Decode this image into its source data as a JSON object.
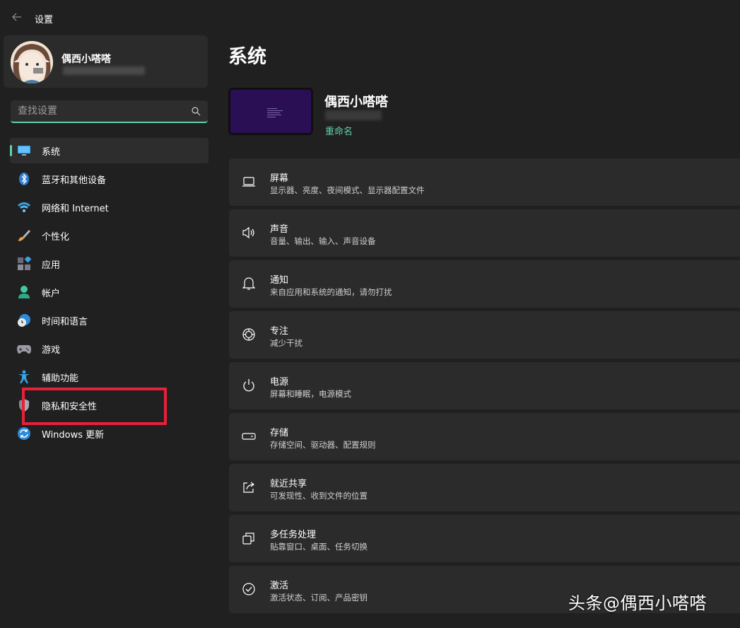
{
  "window": {
    "title": "设置"
  },
  "profile": {
    "name": "偶西小嗒嗒"
  },
  "search": {
    "placeholder": "查找设置"
  },
  "sidebar": {
    "items": [
      {
        "label": "系统",
        "icon": "monitor-icon",
        "active": true
      },
      {
        "label": "蓝牙和其他设备",
        "icon": "bluetooth-icon"
      },
      {
        "label": "网络和 Internet",
        "icon": "wifi-icon"
      },
      {
        "label": "个性化",
        "icon": "brush-icon"
      },
      {
        "label": "应用",
        "icon": "apps-icon"
      },
      {
        "label": "帐户",
        "icon": "person-icon"
      },
      {
        "label": "时间和语言",
        "icon": "globe-clock-icon"
      },
      {
        "label": "游戏",
        "icon": "gamepad-icon"
      },
      {
        "label": "辅助功能",
        "icon": "accessibility-icon"
      },
      {
        "label": "隐私和安全性",
        "icon": "shield-icon",
        "highlighted": true
      },
      {
        "label": "Windows 更新",
        "icon": "update-icon"
      }
    ]
  },
  "main": {
    "title": "系统",
    "device": {
      "name": "偶西小嗒嗒",
      "rename_label": "重命名"
    },
    "settings": [
      {
        "title": "屏幕",
        "desc": "显示器、亮度、夜间模式、显示器配置文件",
        "icon": "laptop-icon"
      },
      {
        "title": "声音",
        "desc": "音量、输出、输入、声音设备",
        "icon": "speaker-icon"
      },
      {
        "title": "通知",
        "desc": "来自应用和系统的通知，请勿打扰",
        "icon": "bell-icon"
      },
      {
        "title": "专注",
        "desc": "减少干扰",
        "icon": "focus-icon"
      },
      {
        "title": "电源",
        "desc": "屏幕和睡眠，电源模式",
        "icon": "power-icon"
      },
      {
        "title": "存储",
        "desc": "存储空间、驱动器、配置规则",
        "icon": "storage-icon"
      },
      {
        "title": "就近共享",
        "desc": "可发现性、收到文件的位置",
        "icon": "share-icon"
      },
      {
        "title": "多任务处理",
        "desc": "贴靠窗口、桌面、任务切换",
        "icon": "multitask-icon"
      },
      {
        "title": "激活",
        "desc": "激活状态、订阅、产品密钥",
        "icon": "check-circle-icon"
      }
    ]
  },
  "watermark": "头条@偶西小嗒嗒",
  "colors": {
    "accent": "#5fd4a8",
    "highlight": "#e8203a",
    "background": "#202020",
    "card": "#2b2b2b"
  }
}
